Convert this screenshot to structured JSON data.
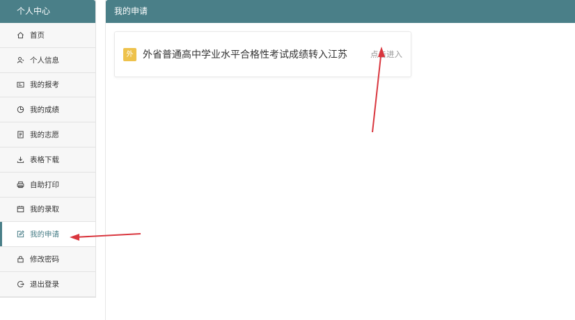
{
  "sidebar": {
    "title": "个人中心",
    "items": [
      {
        "label": "首页",
        "icon": "home-icon"
      },
      {
        "label": "个人信息",
        "icon": "user-icon"
      },
      {
        "label": "我的报考",
        "icon": "id-card-icon"
      },
      {
        "label": "我的成绩",
        "icon": "pie-chart-icon"
      },
      {
        "label": "我的志愿",
        "icon": "document-icon"
      },
      {
        "label": "表格下载",
        "icon": "download-icon"
      },
      {
        "label": "自助打印",
        "icon": "printer-icon"
      },
      {
        "label": "我的录取",
        "icon": "calendar-icon"
      },
      {
        "label": "我的申请",
        "icon": "edit-icon",
        "active": true
      },
      {
        "label": "修改密码",
        "icon": "lock-icon"
      },
      {
        "label": "退出登录",
        "icon": "logout-icon"
      }
    ]
  },
  "main": {
    "title": "我的申请",
    "card": {
      "badge": "外",
      "title": "外省普通高中学业水平合格性考试成绩转入江苏",
      "enter_label": "点击进入"
    }
  },
  "colors": {
    "header_bg": "#4a7f88",
    "badge_bg": "#eec24c",
    "annotation_arrow": "#d9363e"
  }
}
